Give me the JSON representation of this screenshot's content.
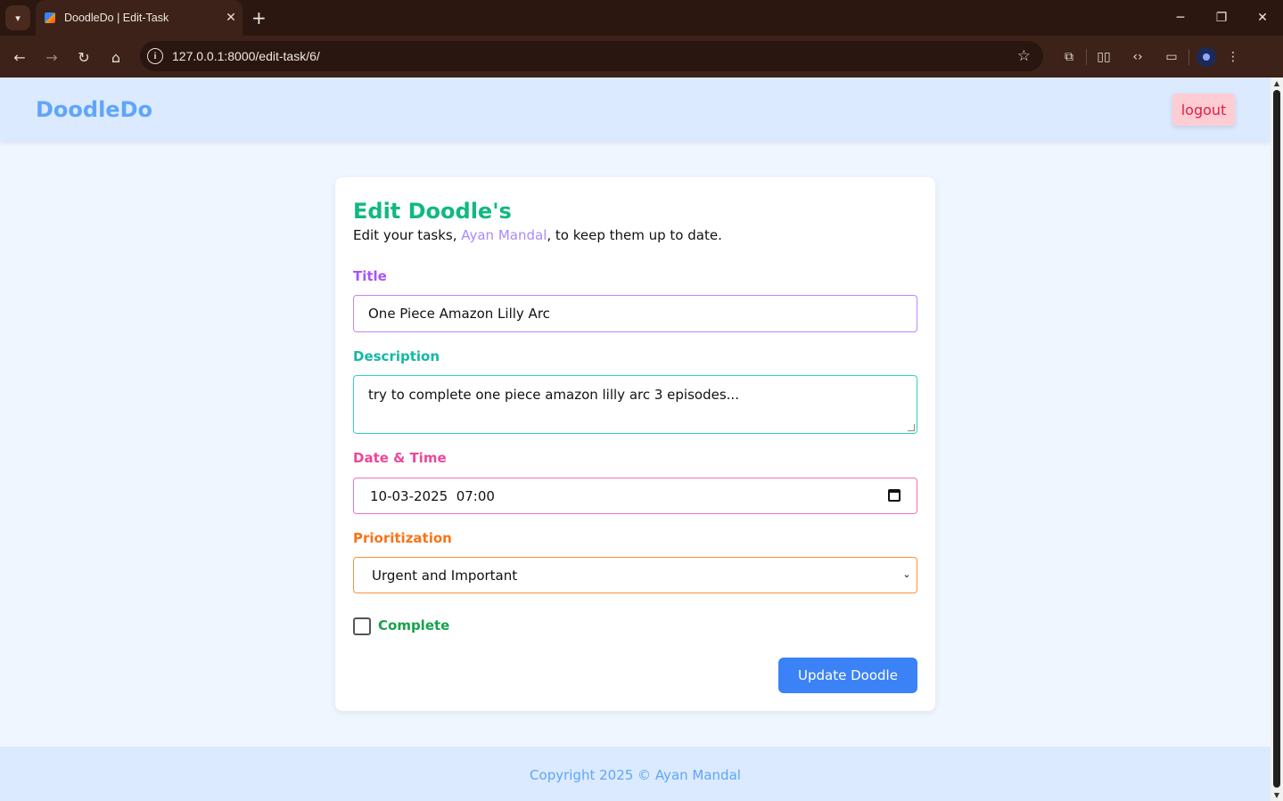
{
  "browser": {
    "tab_title": "DoodleDo | Edit-Task",
    "url": "127.0.0.1:8000/edit-task/6/"
  },
  "navbar": {
    "brand": "DoodleDo",
    "logout_label": "logout"
  },
  "form": {
    "heading": "Edit Doodle's",
    "subtext_prefix": "Edit your tasks, ",
    "user_name": "Ayan Mandal",
    "subtext_suffix": ", to keep them up to date.",
    "title_label": "Title",
    "title_value": "One Piece Amazon Lilly Arc",
    "description_label": "Description",
    "description_value": "try to complete one piece amazon lilly arc 3 episodes...",
    "datetime_label": "Date & Time",
    "datetime_value": "10-03-2025  07:00",
    "priority_label": "Prioritization",
    "priority_value": "Urgent and Important",
    "complete_label": "Complete",
    "complete_checked": false,
    "submit_label": "Update Doodle"
  },
  "footer": {
    "text": "Copyright 2025 © Ayan Mandal"
  },
  "colors": {
    "brand": "#60a5fa",
    "heading": "#10b981",
    "title_label": "#a855f7",
    "description_label": "#14b8a6",
    "datetime_label": "#ec4899",
    "priority_label": "#f97316",
    "complete_label": "#16a34a",
    "submit_bg": "#3b82f6",
    "logout_bg": "#fecdd3"
  }
}
